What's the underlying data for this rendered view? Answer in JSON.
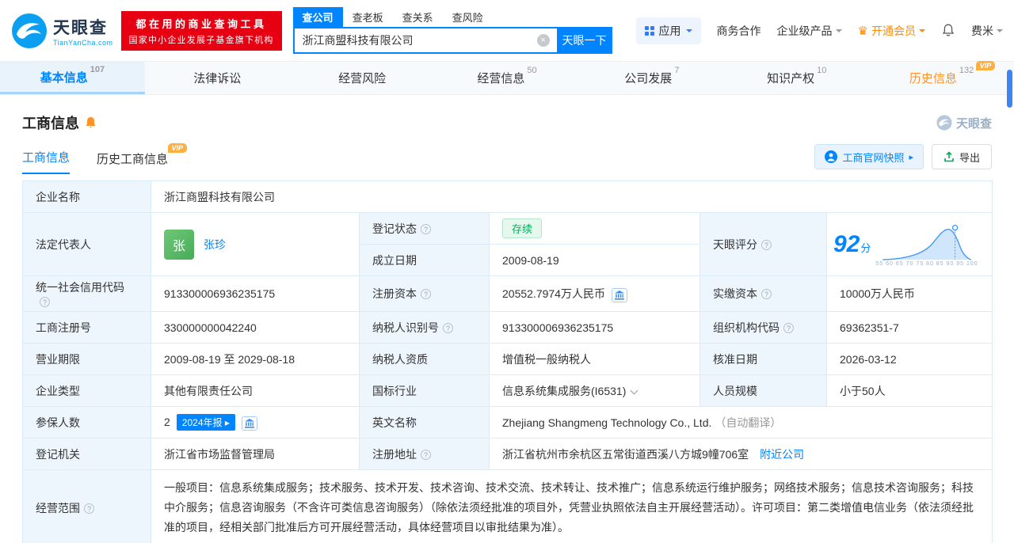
{
  "header": {
    "logo_title": "天眼查",
    "logo_subtitle": "TianYanCha.com",
    "promo_line1": "都在用的商业查询工具",
    "promo_line2": "国家中小企业发展子基金旗下机构",
    "search_tabs": [
      {
        "label": "查公司"
      },
      {
        "label": "查老板"
      },
      {
        "label": "查关系"
      },
      {
        "label": "查风险"
      }
    ],
    "search_value": "浙江商盟科技有限公司",
    "search_button": "天眼一下",
    "nav_app": "应用",
    "nav_cooperation": "商务合作",
    "nav_enterprise": "企业级产品",
    "nav_vip": "开通会员",
    "nav_user": "费米"
  },
  "tabs": [
    {
      "label": "基本信息",
      "count": "107"
    },
    {
      "label": "法律诉讼",
      "count": ""
    },
    {
      "label": "经营风险",
      "count": ""
    },
    {
      "label": "经营信息",
      "count": "50"
    },
    {
      "label": "公司发展",
      "count": "7"
    },
    {
      "label": "知识产权",
      "count": "10"
    },
    {
      "label": "历史信息",
      "count": "132",
      "vip": "VIP"
    }
  ],
  "section": {
    "title": "工商信息",
    "watermark": "天眼查",
    "subtab_active": "工商信息",
    "subtab_history": "历史工商信息",
    "vip_tag": "VIP",
    "snapshot_button": "工商官网快照",
    "snapshot_caret": "▸",
    "export_button": "导出"
  },
  "fields": {
    "company_name": {
      "label": "企业名称",
      "value": "浙江商盟科技有限公司"
    },
    "legal_rep": {
      "label": "法定代表人",
      "avatar": "张",
      "name": "张珍"
    },
    "reg_status": {
      "label": "登记状态",
      "value": "存续"
    },
    "establish_date": {
      "label": "成立日期",
      "value": "2009-08-19"
    },
    "score": {
      "label": "天眼评分",
      "value": "92",
      "unit": "分",
      "axis": "55 60 65 70 75 80 85 90 95 100"
    },
    "credit_code": {
      "label": "统一社会信用代码",
      "value": "913300006936235175"
    },
    "reg_capital": {
      "label": "注册资本",
      "value": "20552.7974万人民币"
    },
    "paid_capital": {
      "label": "实缴资本",
      "value": "10000万人民币"
    },
    "reg_number": {
      "label": "工商注册号",
      "value": "330000000042240"
    },
    "taxpayer_id": {
      "label": "纳税人识别号",
      "value": "913300006936235175"
    },
    "org_code": {
      "label": "组织机构代码",
      "value": "69362351-7"
    },
    "business_term": {
      "label": "营业期限",
      "value": "2009-08-19 至 2029-08-18"
    },
    "taxpayer_quality": {
      "label": "纳税人资质",
      "value": "增值税一般纳税人"
    },
    "approval_date": {
      "label": "核准日期",
      "value": "2026-03-12"
    },
    "company_type": {
      "label": "企业类型",
      "value": "其他有限责任公司"
    },
    "industry": {
      "label": "国标行业",
      "value": "信息系统集成服务(I6531)"
    },
    "staff_size": {
      "label": "人员规模",
      "value": "小于50人"
    },
    "insured_count": {
      "label": "参保人数",
      "value": "2",
      "badge": "2024年报 ▸"
    },
    "english_name": {
      "label": "英文名称",
      "value": "Zhejiang Shangmeng Technology Co., Ltd.",
      "note": "（自动翻译）"
    },
    "reg_authority": {
      "label": "登记机关",
      "value": "浙江省市场监督管理局"
    },
    "reg_address": {
      "label": "注册地址",
      "value": "浙江省杭州市余杭区五常街道西溪八方城9幢706室",
      "link": "附近公司"
    },
    "business_scope": {
      "label": "经营范围",
      "value": "一般项目：信息系统集成服务；技术服务、技术开发、技术咨询、技术交流、技术转让、技术推广；信息系统运行维护服务；网络技术服务；信息技术咨询服务；科技中介服务；信息咨询服务（不含许可类信息咨询服务）（除依法须经批准的项目外，凭营业执照依法自主开展经营活动）。许可项目：第二类增值电信业务（依法须经批准的项目，经相关部门批准后方可开展经营活动，具体经营项目以审批结果为准）。"
    }
  }
}
